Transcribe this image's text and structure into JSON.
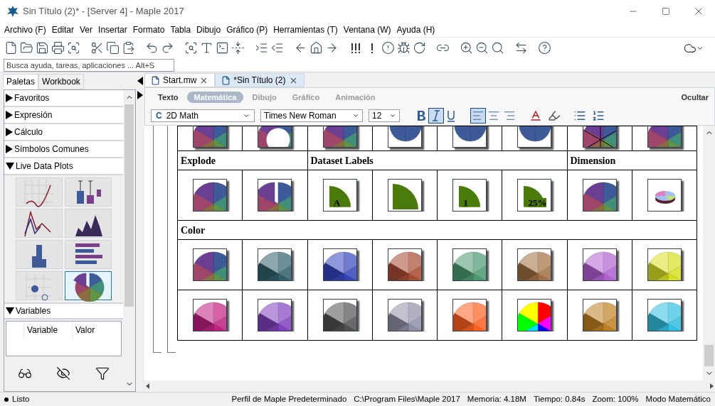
{
  "window": {
    "title": "Sin Título (2)* - [Server 4] - Maple 2017"
  },
  "menu": [
    "Archivo (F)",
    "Editar",
    "Ver",
    "Insertar",
    "Formato",
    "Tabla",
    "Dibujo",
    "Gráfico (P)",
    "Herramientas (T)",
    "Ventana (W)",
    "Ayuda (H)"
  ],
  "search": {
    "placeholder": "Busca ayuda, tareas, aplicaciones ... Alt+S"
  },
  "side_tabs": [
    {
      "label": "Paletas",
      "selected": true
    },
    {
      "label": "Workbook",
      "selected": false
    }
  ],
  "palettes": [
    {
      "label": "Favoritos",
      "expanded": false
    },
    {
      "label": "Expresión",
      "expanded": false
    },
    {
      "label": "Cálculo",
      "expanded": false
    },
    {
      "label": "Símbolos Comunes",
      "expanded": false
    },
    {
      "label": "Live Data Plots",
      "expanded": true
    }
  ],
  "live_plots": [
    {
      "selected": false
    },
    {
      "selected": false
    },
    {
      "selected": false
    },
    {
      "selected": false
    },
    {
      "selected": false
    },
    {
      "selected": false
    },
    {
      "selected": false
    },
    {
      "selected": true
    }
  ],
  "variables": {
    "label": "Variables",
    "expanded": true,
    "columns": [
      "Variable",
      "Valor"
    ]
  },
  "doc_tabs": [
    {
      "label": "Start.mw",
      "selected": false
    },
    {
      "label": "*Sin Título (2)",
      "selected": true
    }
  ],
  "mode_tabs": [
    {
      "label": "Texto",
      "selected": false
    },
    {
      "label": "Matemática",
      "selected": true
    },
    {
      "label": "Dibujo",
      "selected": false
    },
    {
      "label": "Gráfico",
      "selected": false
    },
    {
      "label": "Animación",
      "selected": false
    }
  ],
  "hide_label": "Ocultar",
  "format": {
    "style_glyph": "C",
    "style": "2D Math",
    "font": "Times New Roman",
    "size": "12",
    "bold": false,
    "italic": true,
    "underline": false,
    "align": [
      {
        "selected": true
      },
      {
        "selected": false
      },
      {
        "selected": false
      }
    ]
  },
  "sheet": [
    {
      "kind": "partial",
      "cells": [
        {
          "kind": "pie"
        },
        {
          "kind": "donut"
        },
        {
          "kind": "pie"
        },
        {
          "kind": "fan"
        },
        {
          "kind": "fan"
        },
        {
          "kind": "fan"
        },
        {
          "kind": "spokes"
        },
        {
          "kind": "pie"
        }
      ]
    },
    {
      "kind": "headers",
      "headers": [
        {
          "label": "Explode"
        },
        {
          "label": "Dataset Labels"
        },
        {
          "label": "Dimension"
        }
      ]
    },
    {
      "kind": "icons",
      "cells": [
        {
          "kind": "pie"
        },
        {
          "kind": "exploded"
        },
        {
          "kind": "quarter",
          "label": "A"
        },
        {
          "kind": "quarter"
        },
        {
          "kind": "quarter",
          "label": "1"
        },
        {
          "kind": "quarter",
          "label": "25%"
        },
        {
          "kind": "pie"
        },
        {
          "kind": "disc3d"
        }
      ]
    },
    {
      "kind": "headers",
      "headers": [
        {
          "label": "Color"
        }
      ]
    },
    {
      "kind": "icons",
      "cells": [
        {
          "kind": "pie"
        },
        {
          "kind": "tint",
          "color": "#2f5f6a"
        },
        {
          "kind": "tint",
          "color": "#3344bb"
        },
        {
          "kind": "tint",
          "color": "#a84a30"
        },
        {
          "kind": "tint",
          "color": "#4a9a70"
        },
        {
          "kind": "tint",
          "color": "#a07040"
        },
        {
          "kind": "tint",
          "color": "#b060d0"
        },
        {
          "kind": "tint",
          "color": "#d8e020"
        }
      ]
    },
    {
      "kind": "icons",
      "cells": [
        {
          "kind": "tint",
          "color": "#c02080"
        },
        {
          "kind": "tint",
          "color": "#8040c0"
        },
        {
          "kind": "tint",
          "color": "#505050"
        },
        {
          "kind": "tint",
          "color": "#9090a8"
        },
        {
          "kind": "tint",
          "color": "#ff6020"
        },
        {
          "kind": "rainbow"
        },
        {
          "kind": "tint",
          "color": "#c08020"
        },
        {
          "kind": "tint",
          "color": "#30c0e0"
        }
      ]
    }
  ],
  "status": {
    "state": "Listo",
    "fields": [
      "Perfil de Maple Predeterminado",
      "C:\\Program Files\\Maple 2017",
      "Memoria: 4.18M",
      "Tiempo: 0.84s",
      "Zoom: 100%",
      "Modo Matemático"
    ]
  }
}
